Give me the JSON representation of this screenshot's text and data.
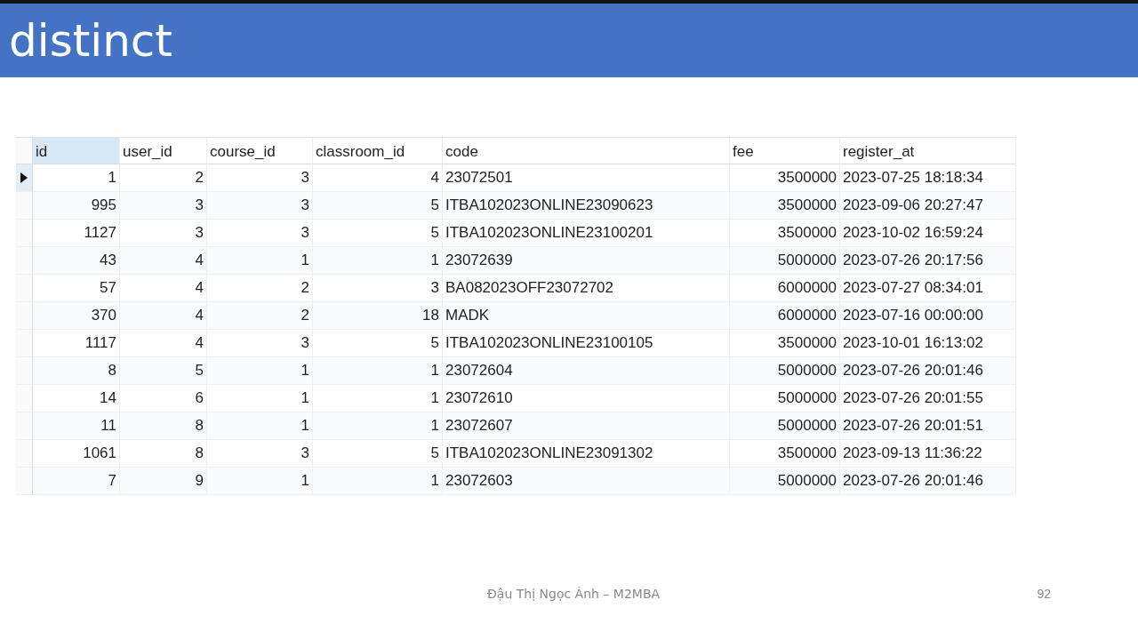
{
  "slide": {
    "title": "distinct",
    "footer": "Đậu Thị Ngọc Ánh – M2MBA",
    "page_number": "92"
  },
  "table": {
    "columns": [
      {
        "label": "id",
        "kind": "number",
        "selected": true
      },
      {
        "label": "user_id",
        "kind": "number",
        "selected": false
      },
      {
        "label": "course_id",
        "kind": "number",
        "selected": false
      },
      {
        "label": "classroom_id",
        "kind": "number",
        "selected": false
      },
      {
        "label": "code",
        "kind": "text",
        "selected": false
      },
      {
        "label": "fee",
        "kind": "number",
        "selected": false
      },
      {
        "label": "register_at",
        "kind": "text",
        "selected": false
      }
    ],
    "rows": [
      {
        "selected": true,
        "cells": [
          "1",
          "2",
          "3",
          "4",
          "23072501",
          "3500000",
          "2023-07-25 18:18:34"
        ]
      },
      {
        "selected": false,
        "cells": [
          "995",
          "3",
          "3",
          "5",
          "ITBA102023ONLINE23090623",
          "3500000",
          "2023-09-06 20:27:47"
        ]
      },
      {
        "selected": false,
        "cells": [
          "1127",
          "3",
          "3",
          "5",
          "ITBA102023ONLINE23100201",
          "3500000",
          "2023-10-02 16:59:24"
        ]
      },
      {
        "selected": false,
        "cells": [
          "43",
          "4",
          "1",
          "1",
          "23072639",
          "5000000",
          "2023-07-26 20:17:56"
        ]
      },
      {
        "selected": false,
        "cells": [
          "57",
          "4",
          "2",
          "3",
          "BA082023OFF23072702",
          "6000000",
          "2023-07-27 08:34:01"
        ]
      },
      {
        "selected": false,
        "cells": [
          "370",
          "4",
          "2",
          "18",
          "MADK",
          "6000000",
          "2023-07-16 00:00:00"
        ]
      },
      {
        "selected": false,
        "cells": [
          "1117",
          "4",
          "3",
          "5",
          "ITBA102023ONLINE23100105",
          "3500000",
          "2023-10-01 16:13:02"
        ]
      },
      {
        "selected": false,
        "cells": [
          "8",
          "5",
          "1",
          "1",
          "23072604",
          "5000000",
          "2023-07-26 20:01:46"
        ]
      },
      {
        "selected": false,
        "cells": [
          "14",
          "6",
          "1",
          "1",
          "23072610",
          "5000000",
          "2023-07-26 20:01:55"
        ]
      },
      {
        "selected": false,
        "cells": [
          "11",
          "8",
          "1",
          "1",
          "23072607",
          "5000000",
          "2023-07-26 20:01:51"
        ]
      },
      {
        "selected": false,
        "cells": [
          "1061",
          "8",
          "3",
          "5",
          "ITBA102023ONLINE23091302",
          "3500000",
          "2023-09-13 11:36:22"
        ]
      },
      {
        "selected": false,
        "cells": [
          "7",
          "9",
          "1",
          "1",
          "23072603",
          "5000000",
          "2023-07-26 20:01:46"
        ]
      }
    ]
  }
}
